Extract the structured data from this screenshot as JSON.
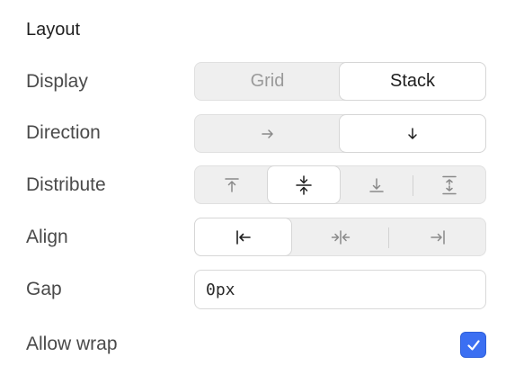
{
  "section": {
    "title": "Layout"
  },
  "display": {
    "label": "Display",
    "options": [
      "Grid",
      "Stack"
    ],
    "selected": "Stack"
  },
  "direction": {
    "label": "Direction",
    "options": [
      {
        "icon": "arrow-right-icon",
        "selected": false
      },
      {
        "icon": "arrow-down-icon",
        "selected": true
      }
    ]
  },
  "distribute": {
    "label": "Distribute",
    "options": [
      {
        "icon": "align-top-icon",
        "selected": false
      },
      {
        "icon": "align-center-vertical-icon",
        "selected": true
      },
      {
        "icon": "align-bottom-icon",
        "selected": false
      },
      {
        "icon": "space-between-vertical-icon",
        "selected": false
      }
    ]
  },
  "align": {
    "label": "Align",
    "options": [
      {
        "icon": "align-left-icon",
        "selected": true
      },
      {
        "icon": "align-center-horizontal-icon",
        "selected": false
      },
      {
        "icon": "align-right-icon",
        "selected": false
      }
    ]
  },
  "gap": {
    "label": "Gap",
    "value": "0px"
  },
  "wrap": {
    "label": "Allow wrap",
    "checked": true
  },
  "colors": {
    "accent": "#3b6ff2",
    "segment_bg": "#efefef",
    "segment_active": "#ffffff",
    "label_text": "#4a4a4a"
  }
}
